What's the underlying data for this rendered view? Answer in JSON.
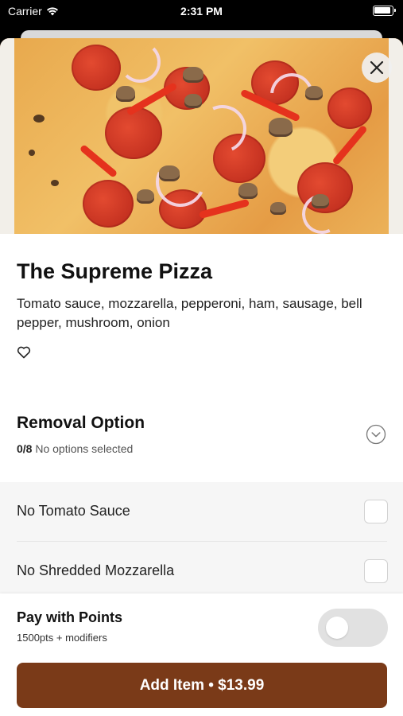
{
  "status_bar": {
    "carrier": "Carrier",
    "time": "2:31 PM",
    "icons": [
      "wifi-icon",
      "battery-icon"
    ]
  },
  "hero": {
    "close_icon": "close-icon"
  },
  "item": {
    "name": "The Supreme Pizza",
    "description": "Tomato sauce, mozzarella, pepperoni, ham, sausage, bell pepper, mushroom, onion",
    "favorite_icon": "heart-outline-icon"
  },
  "removal": {
    "title": "Removal Option",
    "count": "0/8",
    "status": "No options selected",
    "expand_icon": "chevron-down-circle-icon",
    "options": [
      {
        "label": "No Tomato Sauce",
        "checked": false
      },
      {
        "label": "No Shredded Mozzarella",
        "checked": false
      }
    ]
  },
  "points": {
    "title": "Pay with Points",
    "subtitle": "1500pts + modifiers",
    "enabled": false
  },
  "cta": {
    "label": "Add Item • $13.99"
  },
  "colors": {
    "accent": "#7a3a18",
    "toggle_off": "#e1e1e1"
  }
}
